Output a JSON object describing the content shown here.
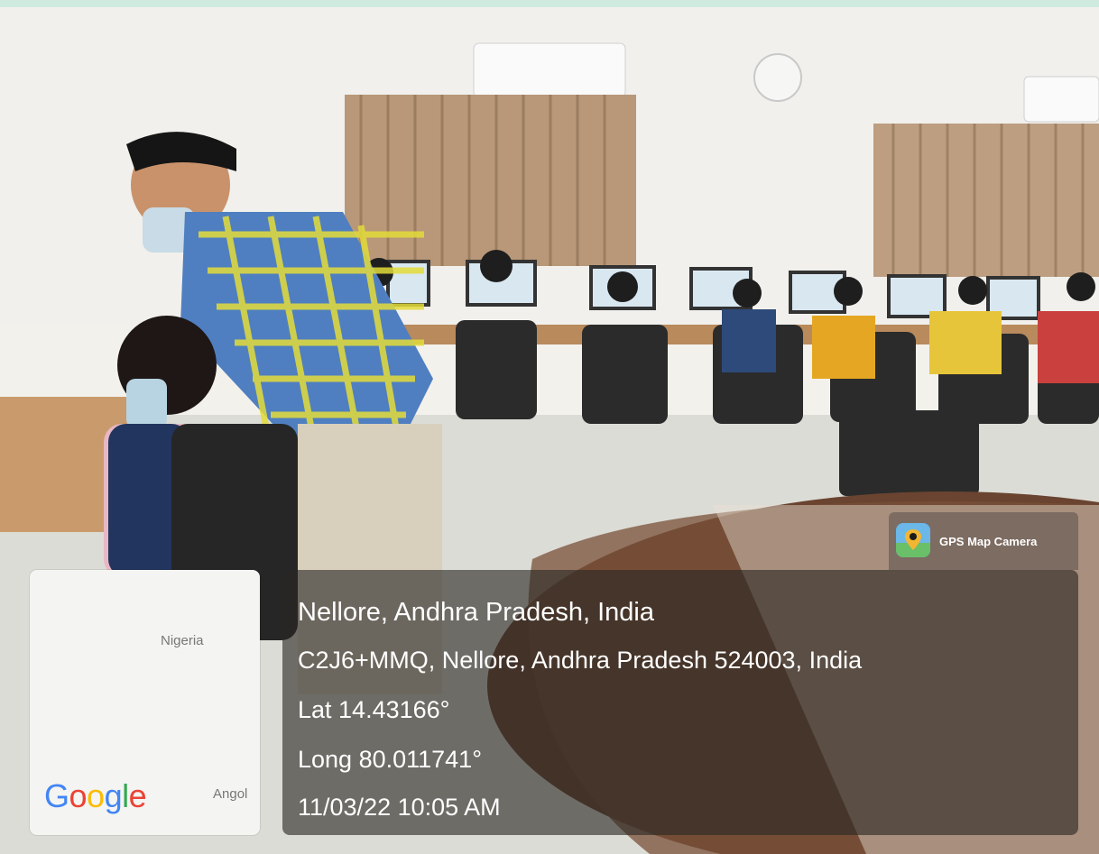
{
  "map": {
    "label_top": "Nigeria",
    "label_bottom": "Angol",
    "logo": [
      "G",
      "o",
      "o",
      "g",
      "l",
      "e"
    ]
  },
  "badge": {
    "label": "GPS Map Camera",
    "icon": "map-pin-icon"
  },
  "location": {
    "title": "Nellore, Andhra Pradesh, India",
    "address": "C2J6+MMQ, Nellore, Andhra Pradesh 524003, India",
    "lat": "Lat 14.43166°",
    "long": "Long 80.011741°",
    "datetime": "11/03/22 10:05 AM"
  },
  "colors": {
    "panel_overlay": "#2a2624",
    "text": "#ffffff",
    "badge_icon": "#3b82d6"
  }
}
